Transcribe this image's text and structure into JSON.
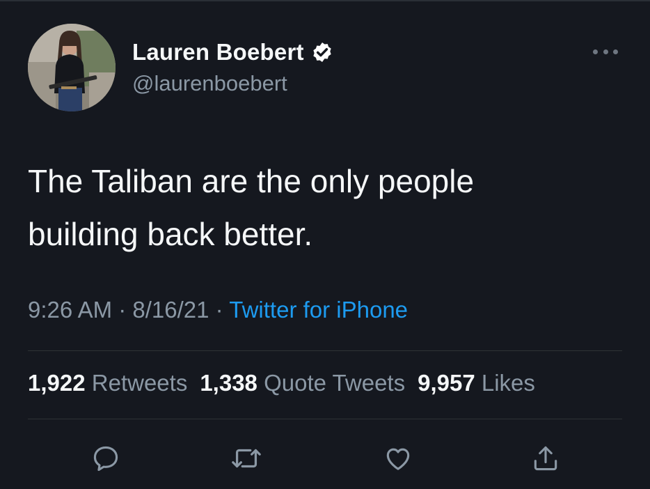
{
  "colors": {
    "background": "#15181f",
    "primary_text": "#f5f7f8",
    "secondary_text": "#8b98a5",
    "link": "#1d9bf0",
    "divider": "#2f3336"
  },
  "author": {
    "display_name": "Lauren Boebert",
    "handle": "@laurenboebert",
    "verified_icon": "verified-badge-icon",
    "avatar_icon": "profile-photo"
  },
  "tweet": {
    "text_line1": "The Taliban are the only people",
    "text_line2": "building back better."
  },
  "meta": {
    "time": "9:26 AM",
    "separator": " · ",
    "date": "8/16/21",
    "source": "Twitter for iPhone"
  },
  "stats": {
    "retweets_count": "1,922",
    "retweets_label": "Retweets",
    "quotes_count": "1,338",
    "quotes_label": "Quote Tweets",
    "likes_count": "9,957",
    "likes_label": "Likes"
  },
  "actions": [
    {
      "icon": "reply-icon"
    },
    {
      "icon": "retweet-icon"
    },
    {
      "icon": "like-heart-icon"
    },
    {
      "icon": "share-icon"
    }
  ]
}
